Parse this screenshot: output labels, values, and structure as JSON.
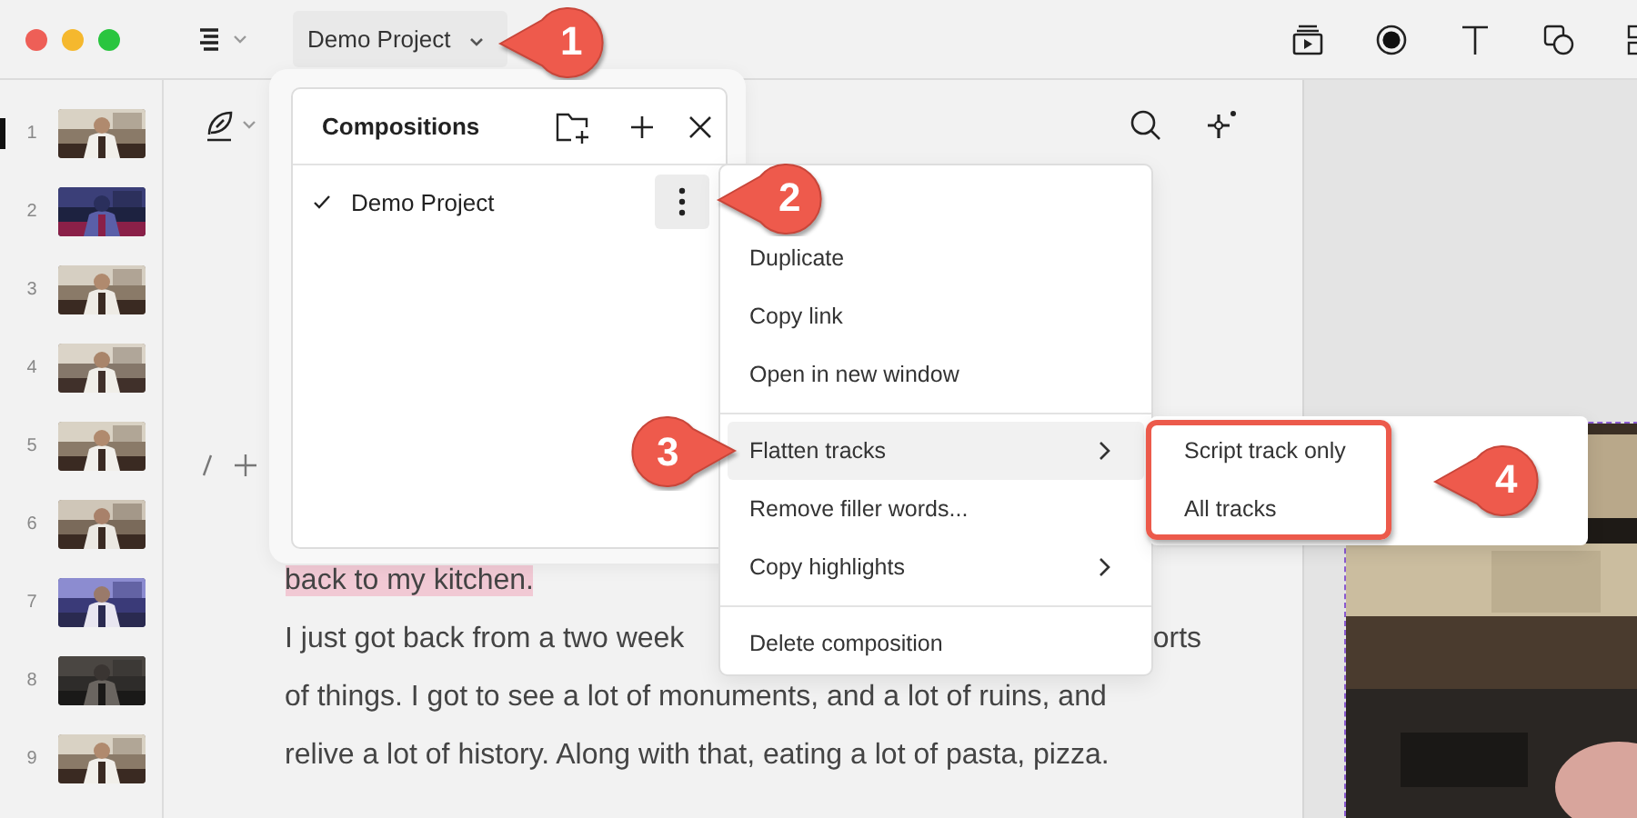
{
  "window": {
    "project_menu": "Demo Project"
  },
  "thumbnails": [
    {
      "number": "1",
      "selected": true
    },
    {
      "number": "2",
      "selected": false
    },
    {
      "number": "3",
      "selected": false
    },
    {
      "number": "4",
      "selected": false
    },
    {
      "number": "5",
      "selected": false
    },
    {
      "number": "6",
      "selected": false
    },
    {
      "number": "7",
      "selected": false
    },
    {
      "number": "8",
      "selected": false
    },
    {
      "number": "9",
      "selected": false
    }
  ],
  "script": {
    "highlighted_line": "back to my kitchen.",
    "first_line_parts": [
      "I just got back from a two week",
      "orts"
    ],
    "lines": [
      "of things. I got to see a lot of monuments, and a lot of ruins, and",
      "relive a lot of history. Along with that, eating a lot of pasta, pizza."
    ]
  },
  "compositions_popover": {
    "title": "Compositions",
    "items": [
      {
        "label": "Demo Project",
        "checked": true
      }
    ]
  },
  "context_menu": {
    "items": [
      {
        "kind": "item",
        "label": "Duplicate",
        "highlighted": false,
        "submenu": false
      },
      {
        "kind": "item",
        "label": "Copy link",
        "highlighted": false,
        "submenu": false
      },
      {
        "kind": "item",
        "label": "Open in new window",
        "highlighted": false,
        "submenu": false
      },
      {
        "kind": "divider"
      },
      {
        "kind": "item",
        "label": "Flatten tracks",
        "highlighted": true,
        "submenu": true
      },
      {
        "kind": "item",
        "label": "Remove filler words...",
        "highlighted": false,
        "submenu": false
      },
      {
        "kind": "item",
        "label": "Copy highlights",
        "highlighted": false,
        "submenu": true
      },
      {
        "kind": "divider"
      },
      {
        "kind": "item",
        "label": "Delete composition",
        "highlighted": false,
        "submenu": false
      }
    ]
  },
  "submenu": {
    "items": [
      {
        "label": "Script track only"
      },
      {
        "label": "All tracks"
      }
    ]
  },
  "annotations": [
    "1",
    "2",
    "3",
    "4"
  ]
}
